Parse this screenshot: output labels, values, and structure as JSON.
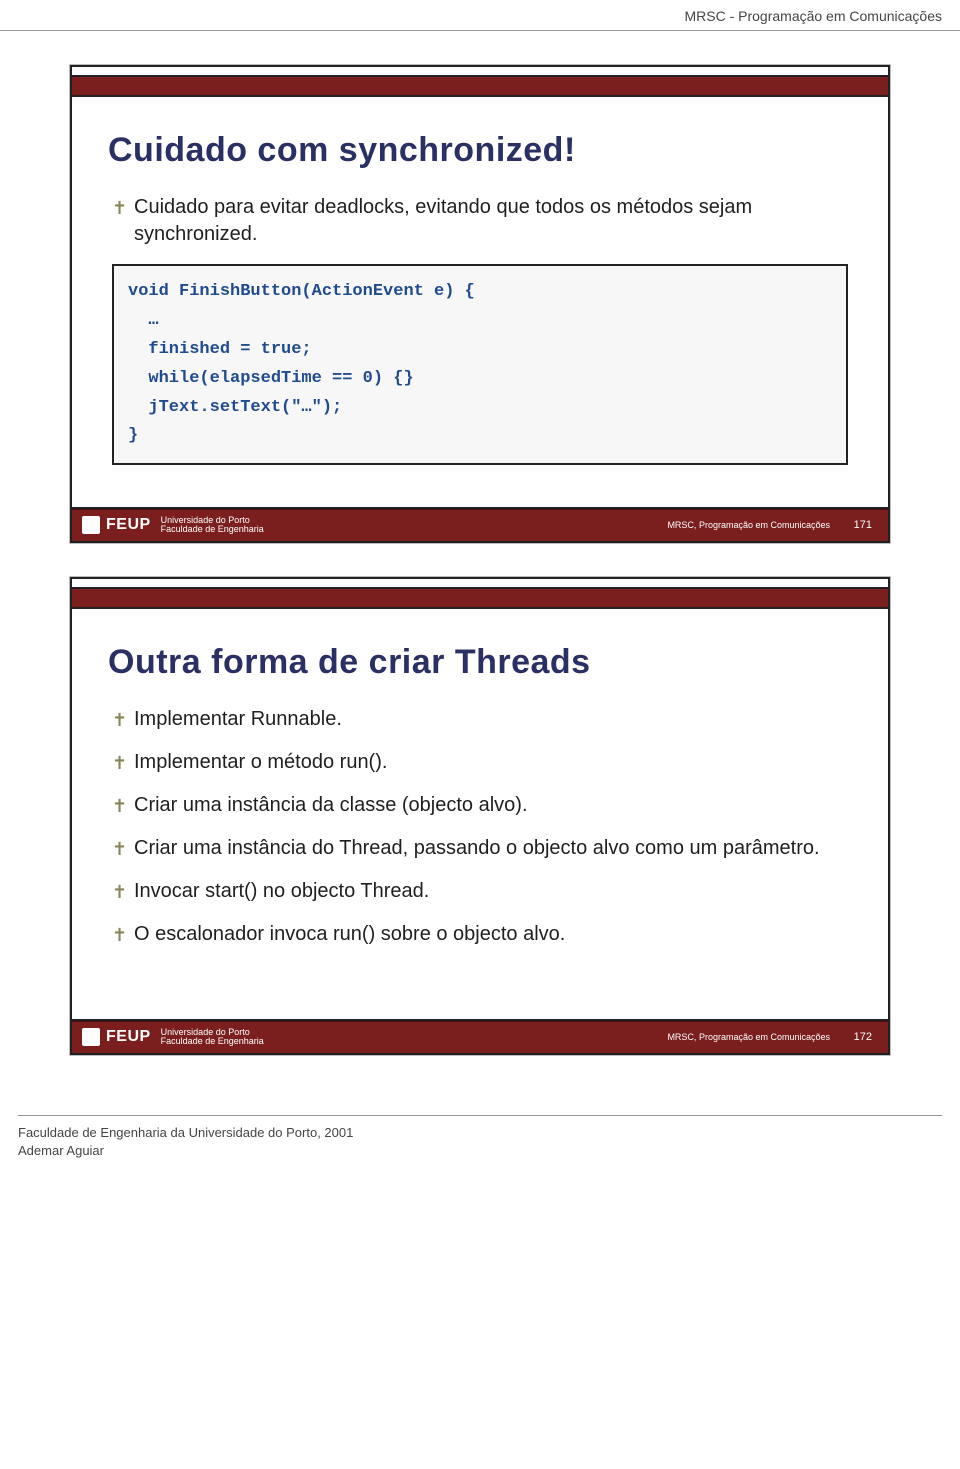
{
  "page_header": "MRSC - Programação em Comunicações",
  "slides": [
    {
      "title": "Cuidado com synchronized!",
      "bullets": [
        "Cuidado para evitar deadlocks, evitando que todos os métodos sejam synchronized."
      ],
      "code": "void FinishButton(ActionEvent e) {\n  …\n  finished = true;\n  while(elapsedTime == 0) {}\n  jText.setText(\"…\");\n}",
      "footer_center": "MRSC, Programação em Comunicações",
      "footer_num": "171",
      "feup_name": "FEUP",
      "feup_line1": "Universidade do Porto",
      "feup_line2": "Faculdade de Engenharia"
    },
    {
      "title": "Outra forma de criar Threads",
      "bullets": [
        "Implementar Runnable.",
        "Implementar o método run().",
        "Criar uma instância da classe (objecto alvo).",
        "Criar uma instância do Thread, passando o objecto alvo como um parâmetro.",
        "Invocar start() no objecto Thread.",
        "O escalonador invoca run() sobre o objecto alvo."
      ],
      "footer_center": "MRSC, Programação em Comunicações",
      "footer_num": "172",
      "feup_name": "FEUP",
      "feup_line1": "Universidade do Porto",
      "feup_line2": "Faculdade de Engenharia"
    }
  ],
  "bottom_footer_line1": "Faculdade de Engenharia da Universidade do Porto, 2001",
  "bottom_footer_line2": "Ademar Aguiar"
}
